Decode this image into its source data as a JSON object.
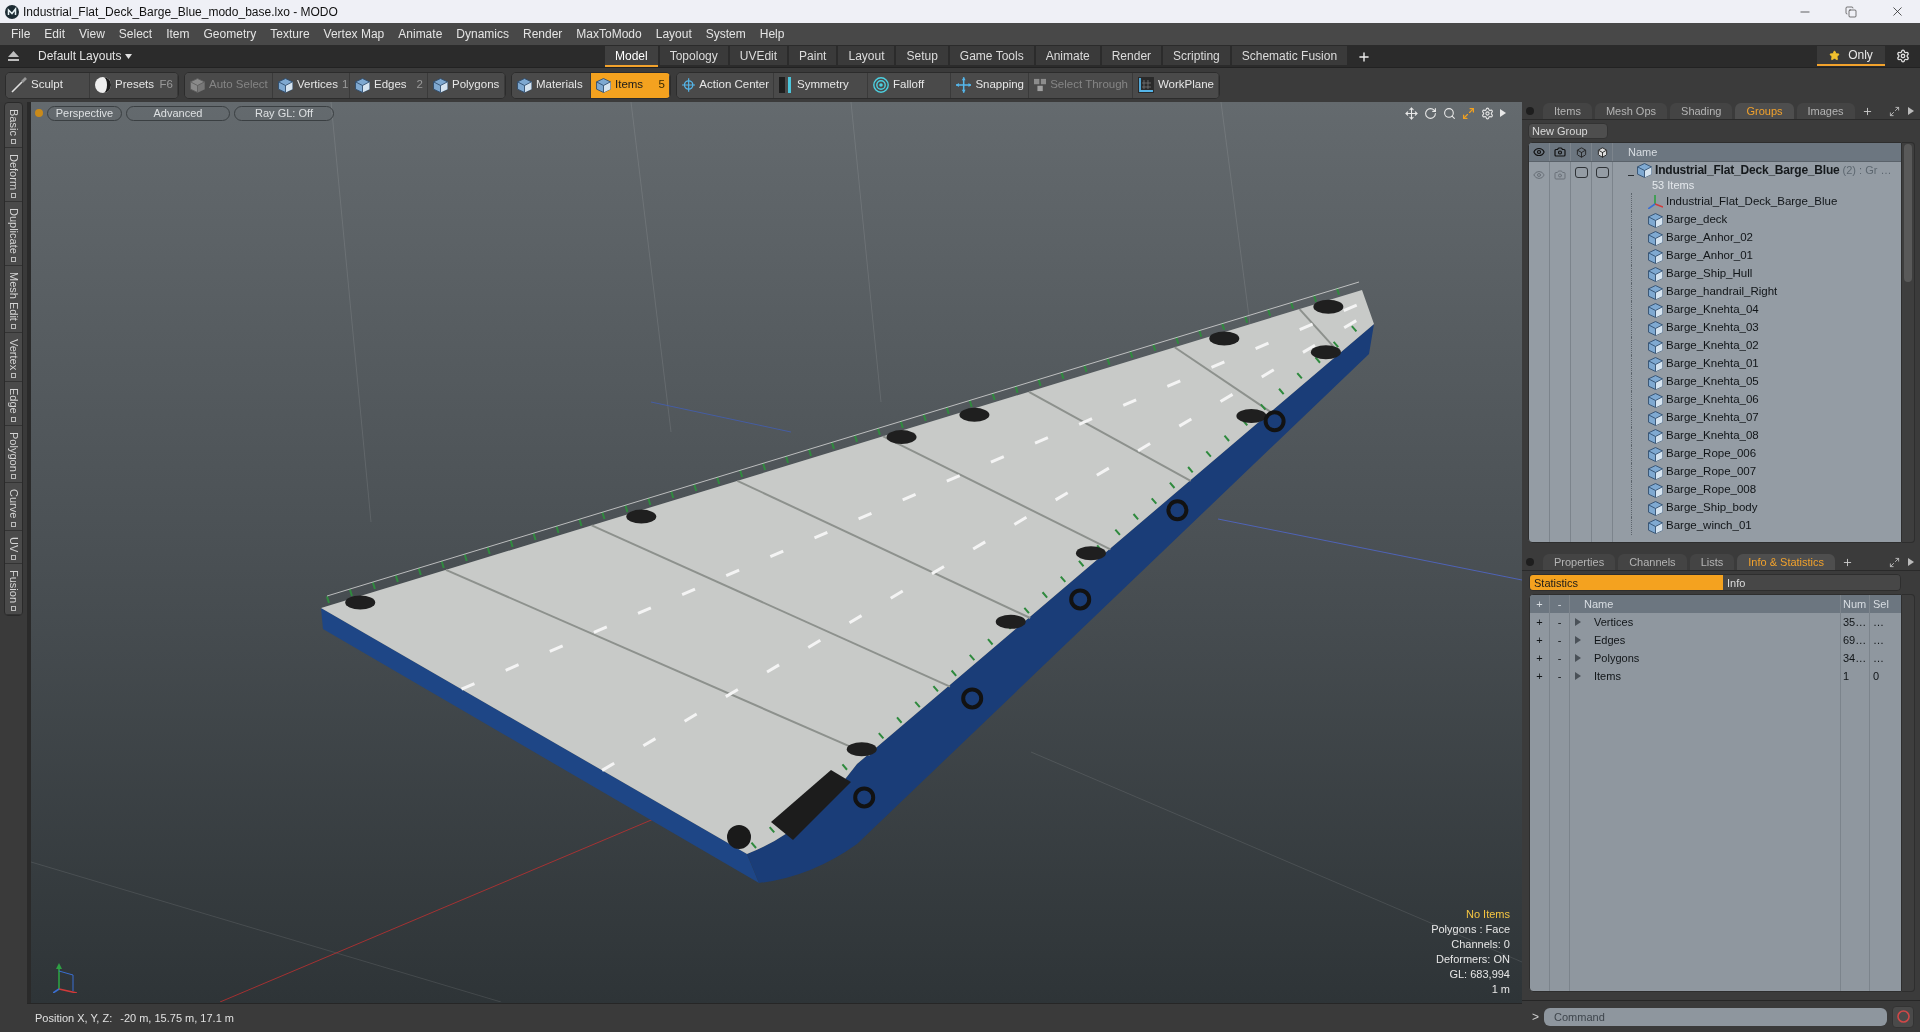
{
  "window": {
    "title": "Industrial_Flat_Deck_Barge_Blue_modo_base.lxo - MODO"
  },
  "menu": [
    "File",
    "Edit",
    "View",
    "Select",
    "Item",
    "Geometry",
    "Texture",
    "Vertex Map",
    "Animate",
    "Dynamics",
    "Render",
    "MaxToModo",
    "Layout",
    "System",
    "Help"
  ],
  "layout_bar": {
    "layouts_menu": "Default Layouts",
    "tabs": [
      {
        "label": "Model",
        "selected": true
      },
      {
        "label": "Topology",
        "selected": false
      },
      {
        "label": "UVEdit",
        "selected": false
      },
      {
        "label": "Paint",
        "selected": false
      },
      {
        "label": "Layout",
        "selected": false
      },
      {
        "label": "Setup",
        "selected": false
      },
      {
        "label": "Game Tools",
        "selected": false
      },
      {
        "label": "Animate",
        "selected": false
      },
      {
        "label": "Render",
        "selected": false
      },
      {
        "label": "Scripting",
        "selected": false
      },
      {
        "label": "Schematic Fusion",
        "selected": false
      }
    ],
    "only_toggle": {
      "label": "Only",
      "on": true
    }
  },
  "toolbar": {
    "groups": [
      [
        {
          "label": "Sculpt",
          "selected": false,
          "disabled": false
        },
        {
          "label": "Presets",
          "shortcut": "F6",
          "selected": false,
          "disabled": false
        }
      ],
      [
        {
          "label": "Auto Select",
          "selected": false,
          "disabled": true
        },
        {
          "label": "Vertices",
          "shortcut": "1",
          "selected": false,
          "disabled": false
        },
        {
          "label": "Edges",
          "shortcut": "2",
          "selected": false,
          "disabled": false
        },
        {
          "label": "Polygons",
          "selected": false,
          "disabled": false
        }
      ],
      [
        {
          "label": "Materials",
          "selected": false,
          "disabled": false
        },
        {
          "label": "Items",
          "shortcut": "5",
          "selected": true,
          "disabled": false
        }
      ],
      [
        {
          "label": "Action Center",
          "selected": false,
          "disabled": false
        },
        {
          "label": "Symmetry",
          "selected": false,
          "disabled": false
        },
        {
          "label": "Falloff",
          "selected": false,
          "disabled": false
        },
        {
          "label": "Snapping",
          "selected": false,
          "disabled": false
        },
        {
          "label": "Select Through",
          "selected": false,
          "disabled": true
        },
        {
          "label": "WorkPlane",
          "selected": false,
          "disabled": false
        }
      ]
    ]
  },
  "side_tabs": [
    "Basic",
    "Deform",
    "Duplicate",
    "Mesh Edit",
    "Vertex",
    "Edge",
    "Polygon",
    "Curve",
    "UV",
    "Fusion"
  ],
  "viewport": {
    "buttons": [
      "Perspective",
      "Advanced",
      "Ray GL: Off"
    ],
    "info": [
      {
        "text": "No Items",
        "kind": "highlight"
      },
      {
        "text": "Polygons : Face",
        "kind": "plain"
      },
      {
        "text": "Channels: 0",
        "kind": "plain"
      },
      {
        "text": "Deformers: ON",
        "kind": "plain"
      },
      {
        "text": "GL: 683,994",
        "kind": "plain"
      },
      {
        "text": "1 m",
        "kind": "plain"
      }
    ]
  },
  "status_bar": {
    "label": "Position X, Y, Z:",
    "value": "-20 m, 15.75 m, 17.1 m"
  },
  "groups_panel": {
    "tabs": [
      {
        "label": "Items",
        "selected": false
      },
      {
        "label": "Mesh Ops",
        "selected": false
      },
      {
        "label": "Shading",
        "selected": false
      },
      {
        "label": "Groups",
        "selected": true
      },
      {
        "label": "Images",
        "selected": false
      }
    ],
    "new_group": "New Group",
    "name_column": "Name",
    "group": {
      "name": "Industrial_Flat_Deck_Barge_Blue",
      "suffix": "(2) : Gr …",
      "count": "53 Items",
      "expanded": true,
      "children": [
        {
          "name": "Industrial_Flat_Deck_Barge_Blue",
          "kind": "locator"
        },
        {
          "name": "Barge_deck",
          "kind": "mesh"
        },
        {
          "name": "Barge_Anhor_02",
          "kind": "mesh"
        },
        {
          "name": "Barge_Anhor_01",
          "kind": "mesh"
        },
        {
          "name": "Barge_Ship_Hull",
          "kind": "mesh"
        },
        {
          "name": "Barge_handrail_Right",
          "kind": "mesh"
        },
        {
          "name": "Barge_Knehta_04",
          "kind": "mesh"
        },
        {
          "name": "Barge_Knehta_03",
          "kind": "mesh"
        },
        {
          "name": "Barge_Knehta_02",
          "kind": "mesh"
        },
        {
          "name": "Barge_Knehta_01",
          "kind": "mesh"
        },
        {
          "name": "Barge_Knehta_05",
          "kind": "mesh"
        },
        {
          "name": "Barge_Knehta_06",
          "kind": "mesh"
        },
        {
          "name": "Barge_Knehta_07",
          "kind": "mesh"
        },
        {
          "name": "Barge_Knehta_08",
          "kind": "mesh"
        },
        {
          "name": "Barge_Rope_006",
          "kind": "mesh"
        },
        {
          "name": "Barge_Rope_007",
          "kind": "mesh"
        },
        {
          "name": "Barge_Rope_008",
          "kind": "mesh"
        },
        {
          "name": "Barge_Ship_body",
          "kind": "mesh"
        },
        {
          "name": "Barge_winch_01",
          "kind": "mesh"
        }
      ]
    }
  },
  "stats_panel": {
    "tabs": [
      {
        "label": "Properties",
        "selected": false
      },
      {
        "label": "Channels",
        "selected": false
      },
      {
        "label": "Lists",
        "selected": false
      },
      {
        "label": "Info & Statistics",
        "selected": true
      }
    ],
    "subtabs": [
      {
        "label": "Statistics",
        "selected": true
      },
      {
        "label": "Info",
        "selected": false
      }
    ],
    "columns": [
      "+",
      "-",
      "Name",
      "Num",
      "Sel"
    ],
    "rows": [
      {
        "add": "+",
        "remove": "-",
        "name": "Vertices",
        "num": "35…",
        "sel": "…"
      },
      {
        "add": "+",
        "remove": "-",
        "name": "Edges",
        "num": "69…",
        "sel": "…"
      },
      {
        "add": "+",
        "remove": "-",
        "name": "Polygons",
        "num": "34…",
        "sel": "…"
      },
      {
        "add": "+",
        "remove": "-",
        "name": "Items",
        "num": "1",
        "sel": "0"
      }
    ]
  },
  "command": {
    "prompt": ">",
    "placeholder": "Command"
  }
}
